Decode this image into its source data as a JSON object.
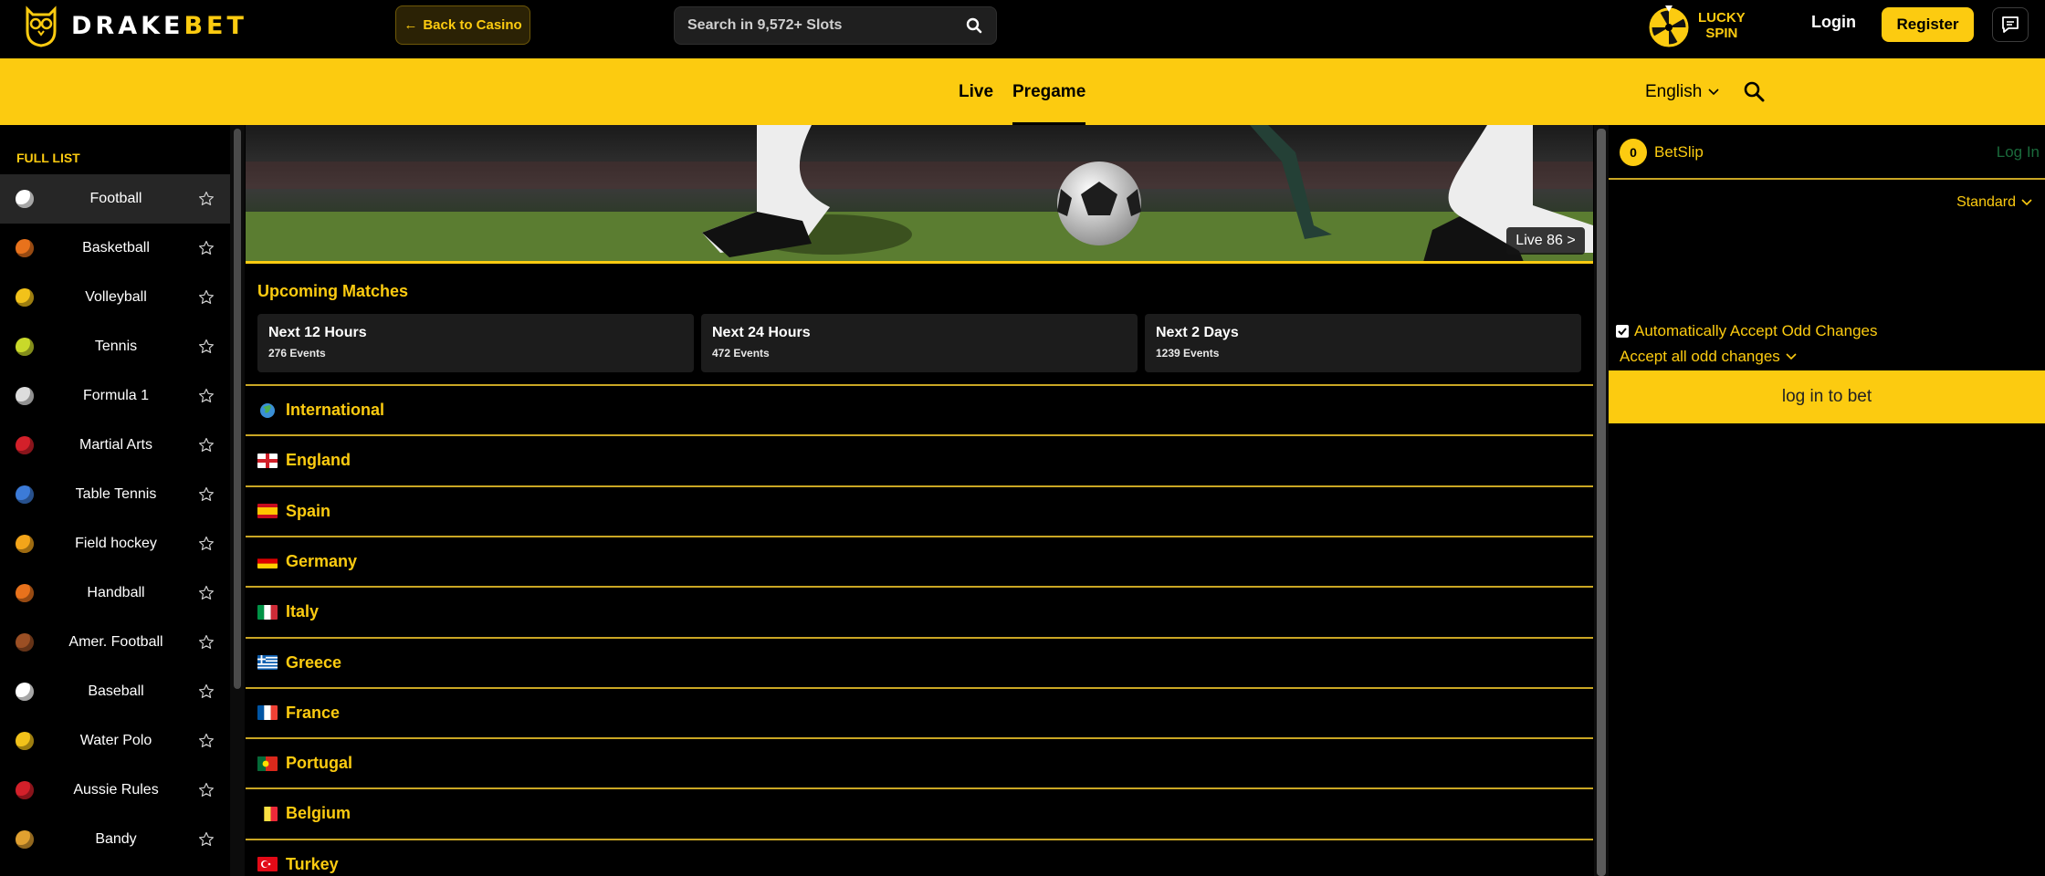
{
  "header": {
    "logo_text_a": "DRAKE",
    "logo_text_b": "BET",
    "back_label": "Back to Casino",
    "search_placeholder": "Search in 9,572+ Slots",
    "lucky_line1": "LUCKY",
    "lucky_line2": "SPIN",
    "login_label": "Login",
    "register_label": "Register",
    "icons": {
      "logo": "owl-logo-icon",
      "search": "search-icon",
      "lucky": "lucky-wheel-icon",
      "chat": "chat-icon",
      "back": "arrow-left-icon"
    }
  },
  "nav": {
    "tabs": [
      {
        "label": "Live"
      },
      {
        "label": "Pregame",
        "active": true
      }
    ],
    "language": "English"
  },
  "sidebar": {
    "title": "FULL LIST",
    "items": [
      {
        "label": "Football",
        "icon": "soccer-ball-icon",
        "color": "#ffffff",
        "active": true
      },
      {
        "label": "Basketball",
        "icon": "basketball-icon",
        "color": "#e8721c"
      },
      {
        "label": "Volleyball",
        "icon": "volleyball-icon",
        "color": "#f2c21a"
      },
      {
        "label": "Tennis",
        "icon": "tennis-ball-icon",
        "color": "#c9d92a"
      },
      {
        "label": "Formula 1",
        "icon": "checkered-flag-icon",
        "color": "#dddddd"
      },
      {
        "label": "Martial Arts",
        "icon": "boxing-glove-icon",
        "color": "#d3202a"
      },
      {
        "label": "Table Tennis",
        "icon": "table-tennis-icon",
        "color": "#3c7bd8"
      },
      {
        "label": "Field hockey",
        "icon": "field-hockey-icon",
        "color": "#f3a51a"
      },
      {
        "label": "Handball",
        "icon": "handball-icon",
        "color": "#e8721c"
      },
      {
        "label": "Amer. Football",
        "icon": "american-football-icon",
        "color": "#9b4f24"
      },
      {
        "label": "Baseball",
        "icon": "baseball-icon",
        "color": "#ffffff"
      },
      {
        "label": "Water Polo",
        "icon": "water-polo-icon",
        "color": "#f2c21a"
      },
      {
        "label": "Aussie Rules",
        "icon": "aussie-rules-ball-icon",
        "color": "#d3202a"
      },
      {
        "label": "Bandy",
        "icon": "bandy-icon",
        "color": "#e0a030"
      }
    ]
  },
  "main": {
    "live_chip": "Live 86 >",
    "upcoming_title": "Upcoming Matches",
    "time_cards": [
      {
        "title": "Next 12 Hours",
        "count": "276 Events"
      },
      {
        "title": "Next 24 Hours",
        "count": "472 Events"
      },
      {
        "title": "Next 2 Days",
        "count": "1239 Events"
      }
    ],
    "countries": [
      {
        "name": "International",
        "flag": "globe-icon"
      },
      {
        "name": "England",
        "flag": "england-flag-icon"
      },
      {
        "name": "Spain",
        "flag": "spain-flag-icon"
      },
      {
        "name": "Germany",
        "flag": "germany-flag-icon"
      },
      {
        "name": "Italy",
        "flag": "italy-flag-icon"
      },
      {
        "name": "Greece",
        "flag": "greece-flag-icon"
      },
      {
        "name": "France",
        "flag": "france-flag-icon"
      },
      {
        "name": "Portugal",
        "flag": "portugal-flag-icon"
      },
      {
        "name": "Belgium",
        "flag": "belgium-flag-icon"
      },
      {
        "name": "Turkey",
        "flag": "turkey-flag-icon"
      }
    ]
  },
  "betslip": {
    "count": "0",
    "title": "BetSlip",
    "login": "Log In",
    "mode": "Standard",
    "auto_accept_label": "Automatically Accept Odd Changes",
    "auto_accept_checked": true,
    "accept_option": "Accept all odd changes",
    "login_to_bet": "log in to bet"
  },
  "colors": {
    "accent": "#fccb10",
    "background": "#000000",
    "card": "#1c1c1c",
    "divider": "#c9a624"
  }
}
